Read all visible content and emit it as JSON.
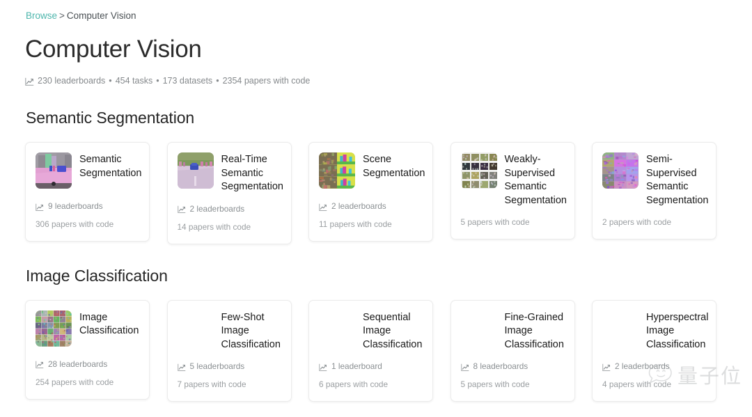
{
  "breadcrumb": {
    "root_label": "Browse",
    "separator": ">",
    "current_label": "Computer Vision"
  },
  "header": {
    "title": "Computer Vision",
    "leaderboards_icon": "line-chart-icon",
    "stats": {
      "leaderboards": "230 leaderboards",
      "tasks": "454 tasks",
      "datasets": "173 datasets",
      "papers": "2354 papers with code",
      "dot": "•"
    }
  },
  "sections": [
    {
      "title": "Semantic Segmentation",
      "cards": [
        {
          "title": "Semantic Segmentation",
          "leaderboards": "9 leaderboards",
          "papers": "306 papers with code",
          "thumbnail": "street-scene-segmentation-thumb",
          "has_thumbnail": true
        },
        {
          "title": "Real-Time Semantic Segmentation",
          "leaderboards": "2 leaderboards",
          "papers": "14 papers with code",
          "thumbnail": "road-scene-segmentation-thumb",
          "has_thumbnail": true
        },
        {
          "title": "Scene Segmentation",
          "leaderboards": "2 leaderboards",
          "papers": "11 papers with code",
          "thumbnail": "scene-grid-thumb",
          "has_thumbnail": true
        },
        {
          "title": "Weakly-Supervised Semantic Segmentation",
          "leaderboards": "",
          "papers": "5 papers with code",
          "thumbnail": "photo-grid-thumb",
          "has_thumbnail": true
        },
        {
          "title": "Semi-Supervised Semantic Segmentation",
          "leaderboards": "",
          "papers": "2 papers with code",
          "thumbnail": "purple-grid-thumb",
          "has_thumbnail": true
        }
      ]
    },
    {
      "title": "Image Classification",
      "cards": [
        {
          "title": "Image Classification",
          "leaderboards": "28 leaderboards",
          "papers": "254 papers with code",
          "thumbnail": "photo-mosaic-thumb",
          "has_thumbnail": true
        },
        {
          "title": "Few-Shot Image Classification",
          "leaderboards": "5 leaderboards",
          "papers": "7 papers with code",
          "thumbnail": "",
          "has_thumbnail": false
        },
        {
          "title": "Sequential Image Classification",
          "leaderboards": "1 leaderboard",
          "papers": "6 papers with code",
          "thumbnail": "",
          "has_thumbnail": false
        },
        {
          "title": "Fine-Grained Image Classification",
          "leaderboards": "8 leaderboards",
          "papers": "5 papers with code",
          "thumbnail": "",
          "has_thumbnail": false
        },
        {
          "title": "Hyperspectral Image Classification",
          "leaderboards": "2 leaderboards",
          "papers": "4 papers with code",
          "thumbnail": "",
          "has_thumbnail": false
        }
      ]
    }
  ],
  "watermark": {
    "text": "量子位",
    "icon": "smiley-speech-bubble-icon"
  },
  "colors": {
    "link_teal": "#4db6ac",
    "title_dark": "#2b2b2b",
    "muted_gray": "#8a8f92",
    "card_border": "#ececec"
  }
}
